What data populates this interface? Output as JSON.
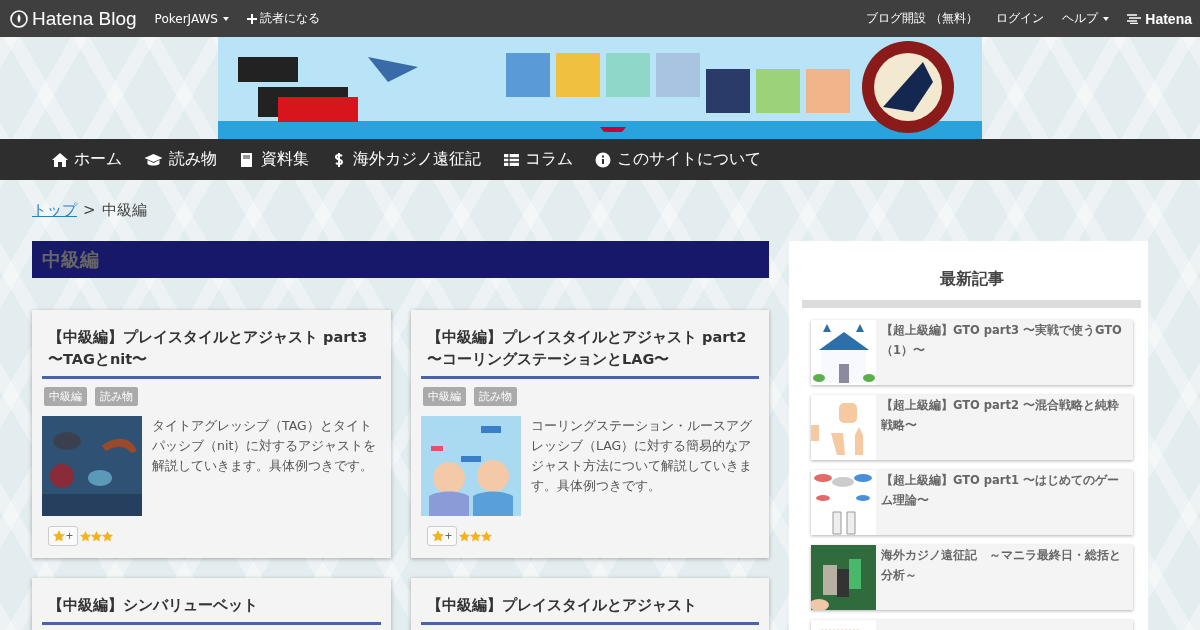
{
  "top_bar": {
    "brand": "Hatena Blog",
    "blog_menu": "PokerJAWS",
    "subscribe": "読者になる",
    "links": [
      "ブログ開設 （無料）",
      "ログイン"
    ],
    "help": "ヘルプ",
    "hatena": "Hatena"
  },
  "banner": {
    "kind": "picture"
  },
  "nav": [
    {
      "label": "ホーム"
    },
    {
      "label": "読み物"
    },
    {
      "label": "資料集"
    },
    {
      "label": "海外カジノ遠征記"
    },
    {
      "label": "コラム"
    },
    {
      "label": "このサイトについて"
    }
  ],
  "breadcrumb": {
    "link": "トップ",
    "separator": ">",
    "current": "中級編"
  },
  "category_title": "中級編",
  "articles": [
    {
      "title": "【中級編】プレイスタイルとアジャスト part3 〜TAGとnit〜",
      "tags": [
        "中級編",
        "読み物"
      ],
      "summary": "タイトアグレッシブ（TAG）とタイトパッシブ（nit）に対するアジャストを解説していきます。具体例つきです。",
      "add_star": "+",
      "stars": 3
    },
    {
      "title": "【中級編】プレイスタイルとアジャスト part2 〜コーリングステーションとLAG〜",
      "tags": [
        "中級編",
        "読み物"
      ],
      "summary": "コーリングステーション・ルースアグレッシブ（LAG）に対する簡易的なアジャスト方法について解説していきます。具体例つきです。",
      "add_star": "+",
      "stars": 3
    },
    {
      "title": "【中級編】シンバリューベット"
    },
    {
      "title": "【中級編】プレイスタイルとアジャスト"
    }
  ],
  "sidebar": {
    "title": "最新記事",
    "items": [
      {
        "title": "【超上級編】GTO part3 〜実戦で使うGTO（1）〜"
      },
      {
        "title": "【超上級編】GTO part2 〜混合戦略と純粋戦略〜"
      },
      {
        "title": "【超上級編】GTO part1 〜はじめてのゲーム理論〜"
      },
      {
        "title": "海外カジノ遠征記　～マニラ最終日・総括と分析～"
      },
      {
        "kind": "picture"
      }
    ]
  }
}
